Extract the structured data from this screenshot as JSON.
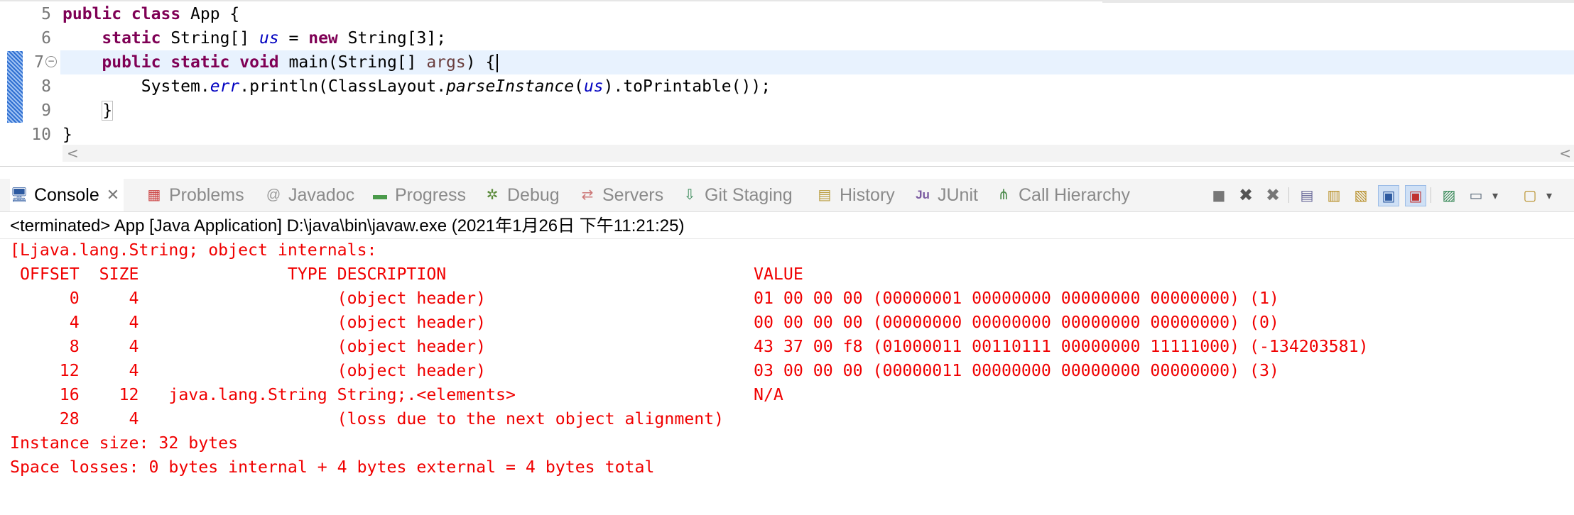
{
  "editor": {
    "line_numbers": [
      "5",
      "6",
      "7",
      "8",
      "9",
      "10"
    ],
    "collapse_glyph": "−",
    "code": {
      "l5_kw": "public class",
      "l5_rest": " App {",
      "l6_kw": "static",
      "l6_type": " String[] ",
      "l6_field": "us",
      "l6_eq": " = ",
      "l6_new": "new",
      "l6_rest": " String[3];",
      "l7_kw": "public static void",
      "l7_mid": " main(String[] ",
      "l7_param": "args",
      "l7_end": ") {",
      "l8_a": "System.",
      "l8_err": "err",
      "l8_b": ".println(ClassLayout.",
      "l8_parse": "parseInstance",
      "l8_c": "(",
      "l8_us": "us",
      "l8_d": ").toPrintable());",
      "l9": "}",
      "l10": "}"
    },
    "scroll_left": "<",
    "scroll_right": "<"
  },
  "tabs": [
    {
      "label": "Console",
      "icon": "console-icon",
      "glyph": "🖥",
      "close": "✕"
    },
    {
      "label": "Problems",
      "icon": "problems-icon",
      "glyph": "▦"
    },
    {
      "label": "Javadoc",
      "icon": "javadoc-icon",
      "glyph": "@"
    },
    {
      "label": "Progress",
      "icon": "progress-icon",
      "glyph": "▬"
    },
    {
      "label": "Debug",
      "icon": "debug-icon",
      "glyph": "✲"
    },
    {
      "label": "Servers",
      "icon": "servers-icon",
      "glyph": "⇄"
    },
    {
      "label": "Git Staging",
      "icon": "git-staging-icon",
      "glyph": "⇩"
    },
    {
      "label": "History",
      "icon": "history-icon",
      "glyph": "▤"
    },
    {
      "label": "JUnit",
      "icon": "junit-icon",
      "glyph": "Ju"
    },
    {
      "label": "Call Hierarchy",
      "icon": "call-hierarchy-icon",
      "glyph": "⋔"
    }
  ],
  "toolbar_glyphs": {
    "terminate": "■",
    "remove": "✖",
    "remove_all": "✖",
    "clear": "▤",
    "scroll_lock": "▥",
    "word_wrap": "▧",
    "show_stdout": "▣",
    "show_stderr": "▣",
    "pin": "▨",
    "display": "▭",
    "dropdown": "▾",
    "new_console": "▢"
  },
  "console": {
    "status": "<terminated> App [Java Application] D:\\java\\bin\\javaw.exe (2021年1月26日 下午11:21:25)",
    "lines": [
      "[Ljava.lang.String; object internals:",
      " OFFSET  SIZE               TYPE DESCRIPTION                               VALUE",
      "      0     4                    (object header)                           01 00 00 00 (00000001 00000000 00000000 00000000) (1)",
      "      4     4                    (object header)                           00 00 00 00 (00000000 00000000 00000000 00000000) (0)",
      "      8     4                    (object header)                           43 37 00 f8 (01000011 00110111 00000000 11111000) (-134203581)",
      "     12     4                    (object header)                           03 00 00 00 (00000011 00000000 00000000 00000000) (3)",
      "     16    12   java.lang.String String;.<elements>                        N/A",
      "     28     4                    (loss due to the next object alignment)",
      "Instance size: 32 bytes",
      "Space losses: 0 bytes internal + 4 bytes external = 4 bytes total"
    ]
  },
  "colors": {
    "keyword": "#7f0055",
    "field": "#0000c0",
    "stderr": "#f00000",
    "current_line": "#e8f2fe"
  }
}
